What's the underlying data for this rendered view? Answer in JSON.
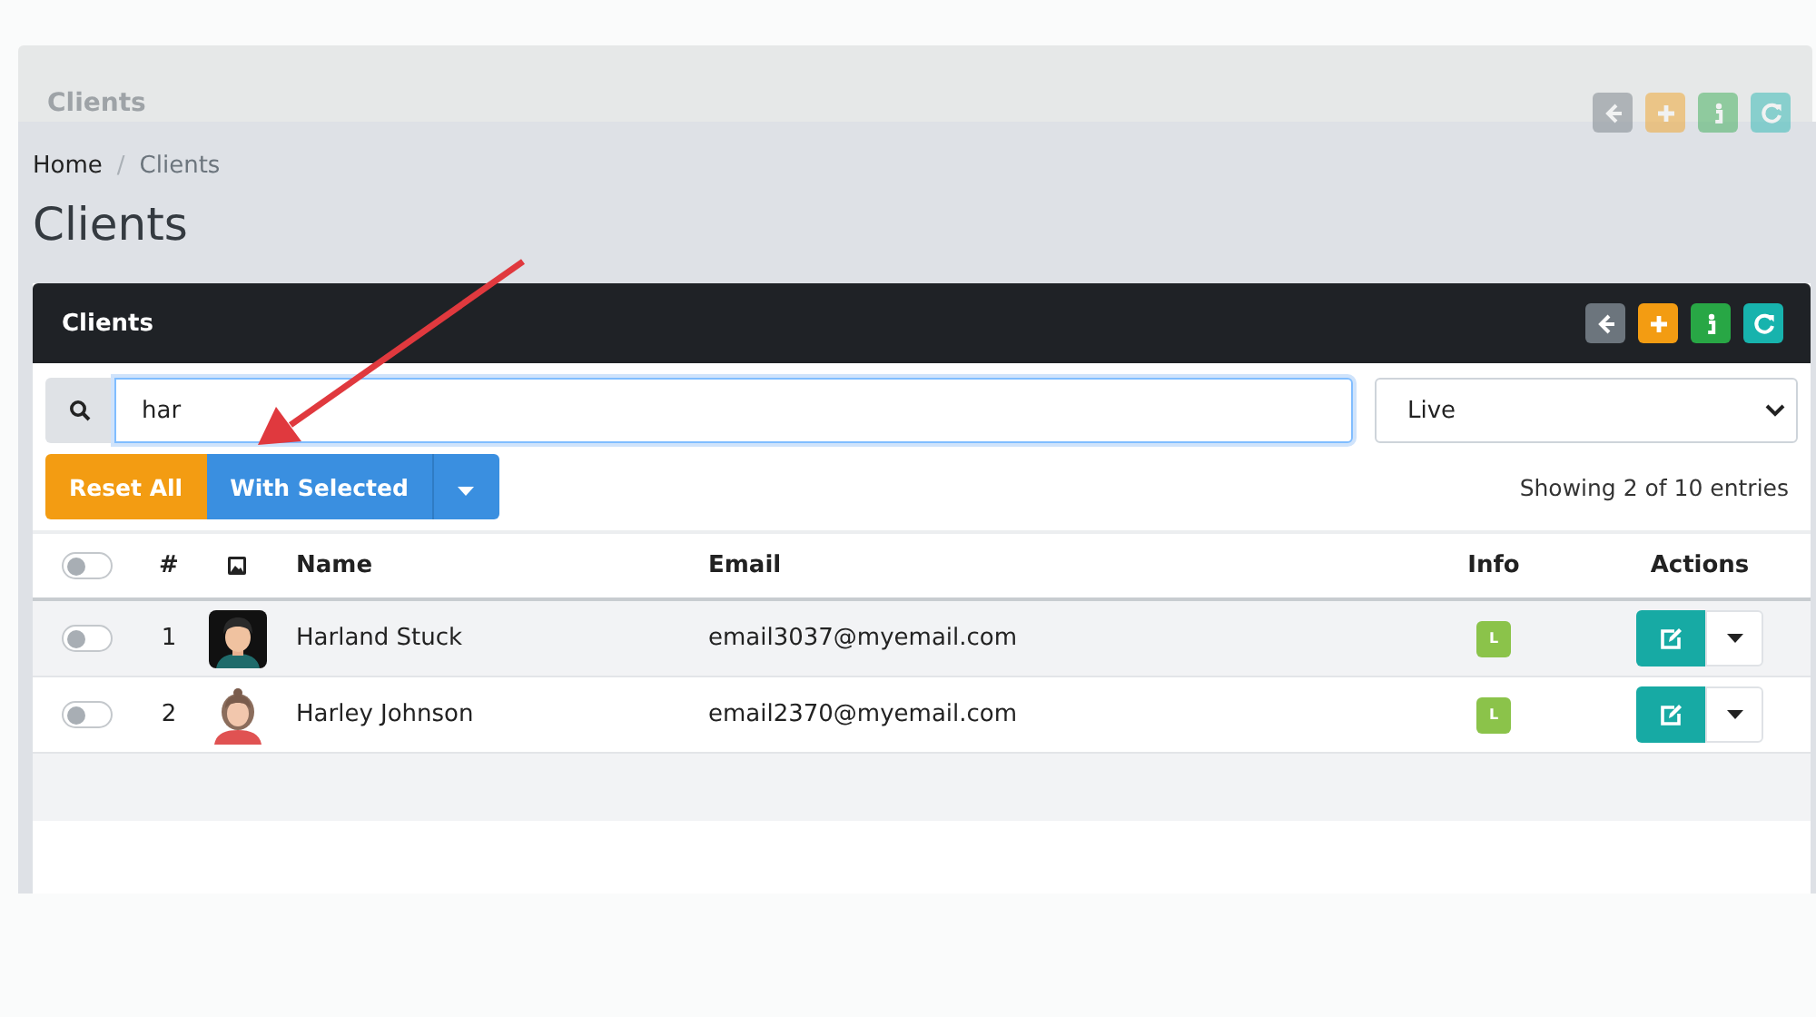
{
  "background_card": {
    "title": "Clients",
    "tools": [
      {
        "kind": "back"
      },
      {
        "kind": "add"
      },
      {
        "kind": "info"
      },
      {
        "kind": "refresh"
      }
    ]
  },
  "breadcrumb": {
    "separator": "/",
    "items": [
      {
        "label": "Home",
        "current": false
      },
      {
        "label": "Clients",
        "current": true
      }
    ]
  },
  "page_title": "Clients",
  "card": {
    "title": "Clients",
    "tools": [
      {
        "kind": "back"
      },
      {
        "kind": "add"
      },
      {
        "kind": "info"
      },
      {
        "kind": "refresh"
      }
    ]
  },
  "search": {
    "value": "har"
  },
  "status_filter": {
    "value": "Live"
  },
  "buttons": {
    "reset": "Reset All",
    "with_selected": "With Selected"
  },
  "entries_info": "Showing 2 of 10 entries",
  "table": {
    "select_all": {
      "checked": false
    },
    "columns": [
      "#",
      "Name",
      "Email",
      "Info",
      "Actions"
    ],
    "rows": [
      {
        "checked": false,
        "number": "1",
        "name": "Harland Stuck",
        "email": "email3037@myemail.com",
        "info": "L"
      },
      {
        "checked": false,
        "number": "2",
        "name": "Harley Johnson",
        "email": "email2370@myemail.com",
        "info": "L"
      }
    ]
  },
  "annotation": {
    "kind": "arrow"
  }
}
